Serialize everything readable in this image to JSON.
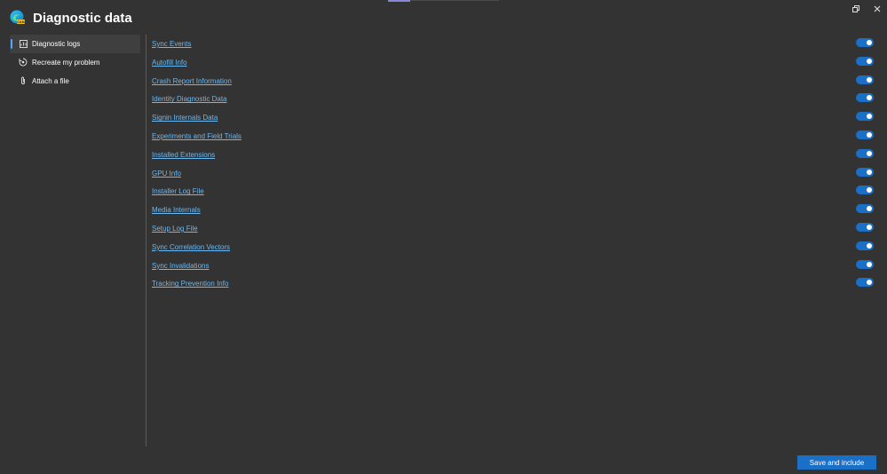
{
  "header": {
    "title": "Diagnostic data",
    "logo_icon": "edge-canary-logo-icon"
  },
  "sidebar": {
    "items": [
      {
        "label": "Diagnostic logs",
        "icon": "log-icon",
        "active": true
      },
      {
        "label": "Recreate my problem",
        "icon": "record-icon",
        "active": false
      },
      {
        "label": "Attach a file",
        "icon": "paperclip-icon",
        "active": false
      }
    ]
  },
  "logs": {
    "items": [
      {
        "label": "Sync Events",
        "enabled": true
      },
      {
        "label": "Autofill Info",
        "enabled": true
      },
      {
        "label": "Crash Report Information",
        "enabled": true
      },
      {
        "label": "Identity Diagnostic Data",
        "enabled": true
      },
      {
        "label": "Signin Internals Data",
        "enabled": true
      },
      {
        "label": "Experiments and Field Trials",
        "enabled": true
      },
      {
        "label": "Installed Extensions",
        "enabled": true
      },
      {
        "label": "GPU Info",
        "enabled": true
      },
      {
        "label": "Installer Log File",
        "enabled": true
      },
      {
        "label": "Media Internals",
        "enabled": true
      },
      {
        "label": "Setup Log File",
        "enabled": true
      },
      {
        "label": "Sync Correlation Vectors",
        "enabled": true
      },
      {
        "label": "Sync Invalidations",
        "enabled": true
      },
      {
        "label": "Tracking Prevention Info",
        "enabled": true
      }
    ]
  },
  "footer": {
    "save_label": "Save and include"
  },
  "colors": {
    "background": "#333333",
    "accent": "#1a6fc7",
    "link": "#6cb8f0"
  }
}
